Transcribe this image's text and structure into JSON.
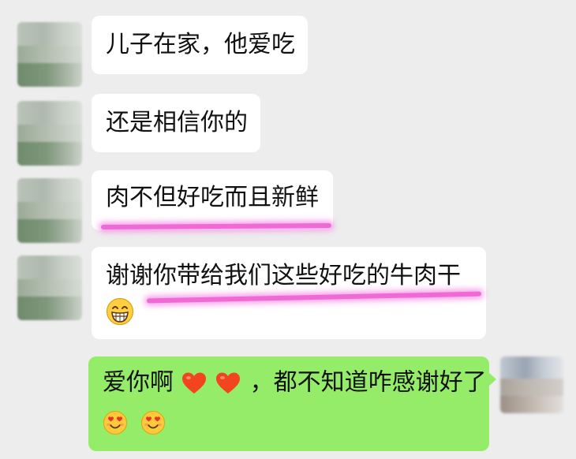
{
  "chat": {
    "messages": [
      {
        "sender": "contact",
        "text": "儿子在家，他爱吃"
      },
      {
        "sender": "contact",
        "text": "还是相信你的"
      },
      {
        "sender": "contact",
        "text": "肉不但好吃而且新鲜"
      },
      {
        "sender": "contact",
        "text": "谢谢你带给我们这些好吃的牛肉干",
        "emoji": "grinning-face-icon"
      },
      {
        "sender": "me",
        "text_before": "爱你啊",
        "hearts": [
          "heart-icon",
          "heart-icon"
        ],
        "text_after": "，都不知道咋感谢好了",
        "emojis": [
          "smiling-face-hearts-icon",
          "smiling-face-hearts-icon"
        ]
      }
    ]
  },
  "colors": {
    "background": "#ededed",
    "received_bubble": "#ffffff",
    "sent_bubble": "#95ec69",
    "highlight": "#f06ad5",
    "text": "#111111"
  }
}
